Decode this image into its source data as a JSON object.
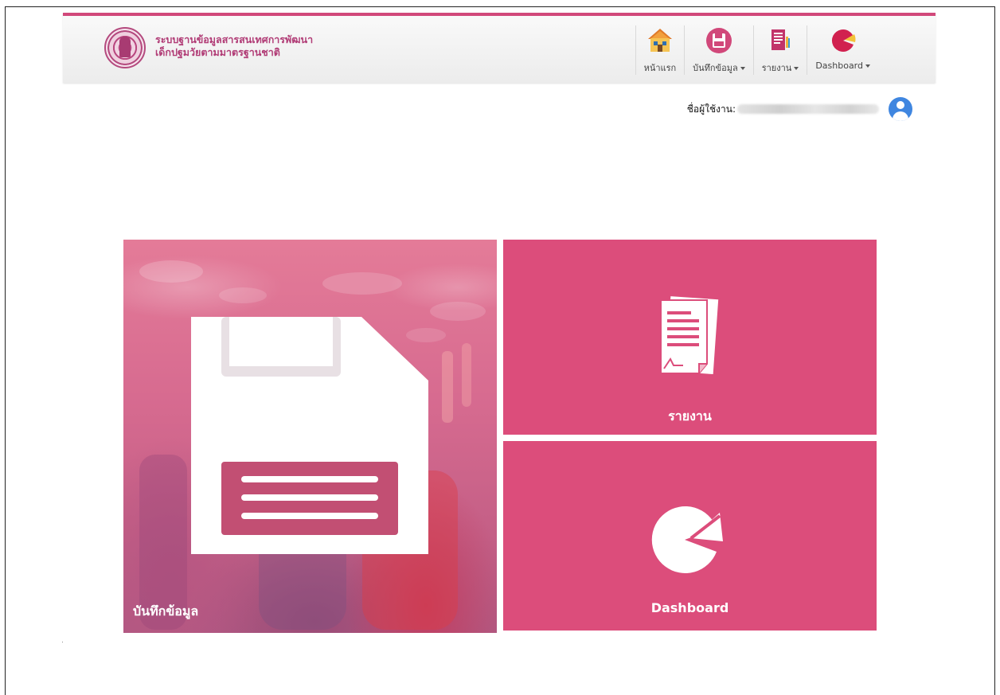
{
  "header": {
    "title_line1": "ระบบฐานข้อมูลสารสนเทศการพัฒนา",
    "title_line2": "เด็กปฐมวัยตามมาตรฐานชาติ",
    "accent_color": "#d1487a"
  },
  "nav": {
    "home": {
      "label": "หน้าแรก",
      "icon": "home-icon"
    },
    "record": {
      "label": "บันทึกข้อมูล",
      "icon": "save-icon"
    },
    "report": {
      "label": "รายงาน",
      "icon": "report-icon"
    },
    "dashboard": {
      "label": "Dashboard",
      "icon": "pie-chart-icon"
    }
  },
  "user": {
    "label": "ชื่อผู้ใช้งาน:",
    "name": "",
    "avatar_color": "#3f86e0"
  },
  "tiles": {
    "record": {
      "caption": "บันทึกข้อมูล",
      "icon": "floppy-disk-icon"
    },
    "report": {
      "caption": "รายงาน",
      "icon": "document-icon"
    },
    "dashboard": {
      "caption": "Dashboard",
      "icon": "pie-chart-icon"
    },
    "tile_color": "#dc4d7b"
  }
}
